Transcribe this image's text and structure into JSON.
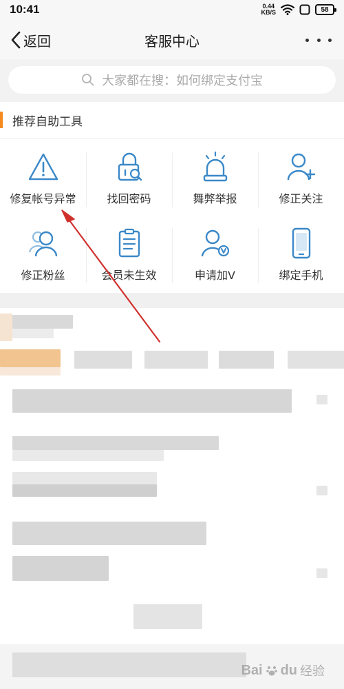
{
  "status_bar": {
    "time": "10:41",
    "net_speed_value": "0.44",
    "net_speed_unit": "KB/S",
    "battery": "58"
  },
  "nav": {
    "back_label": "返回",
    "title": "客服中心"
  },
  "search": {
    "placeholder": "大家都在搜：如何绑定支付宝"
  },
  "section": {
    "title": "推荐自助工具"
  },
  "tools": [
    {
      "label": "修复帐号异常",
      "icon": "warning-triangle-icon"
    },
    {
      "label": "找回密码",
      "icon": "lock-search-icon"
    },
    {
      "label": "舞弊举报",
      "icon": "alarm-siren-icon"
    },
    {
      "label": "修正关注",
      "icon": "user-plus-icon"
    },
    {
      "label": "修正粉丝",
      "icon": "users-group-icon"
    },
    {
      "label": "会员未生效",
      "icon": "clipboard-list-icon"
    },
    {
      "label": "申请加V",
      "icon": "user-verified-icon"
    },
    {
      "label": "绑定手机",
      "icon": "mobile-phone-icon"
    }
  ],
  "colors": {
    "accent": "#f58a1f",
    "icon": "#3a88c8",
    "annotation_arrow": "#d0312d"
  },
  "watermark": {
    "brand": "Bai",
    "brand_suffix": "du",
    "sub": "经验"
  }
}
